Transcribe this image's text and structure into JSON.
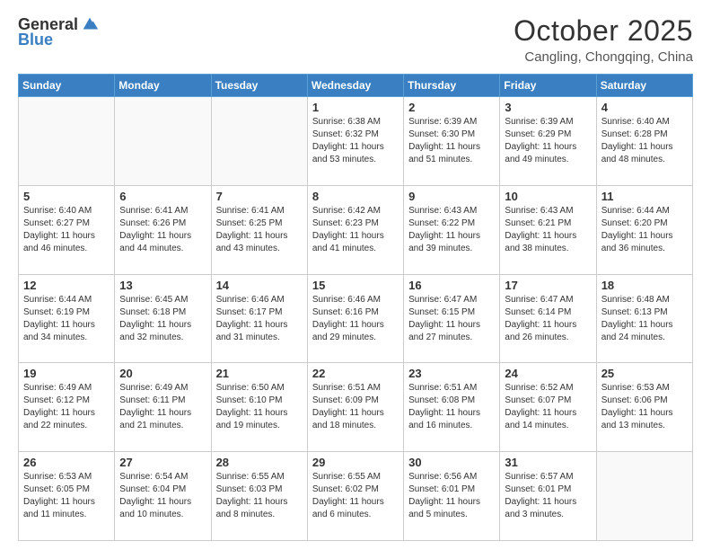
{
  "header": {
    "logo_general": "General",
    "logo_blue": "Blue",
    "month": "October 2025",
    "location": "Cangling, Chongqing, China"
  },
  "weekdays": [
    "Sunday",
    "Monday",
    "Tuesday",
    "Wednesday",
    "Thursday",
    "Friday",
    "Saturday"
  ],
  "weeks": [
    [
      {
        "day": "",
        "sunrise": "",
        "sunset": "",
        "daylight": ""
      },
      {
        "day": "",
        "sunrise": "",
        "sunset": "",
        "daylight": ""
      },
      {
        "day": "",
        "sunrise": "",
        "sunset": "",
        "daylight": ""
      },
      {
        "day": "1",
        "sunrise": "Sunrise: 6:38 AM",
        "sunset": "Sunset: 6:32 PM",
        "daylight": "Daylight: 11 hours and 53 minutes."
      },
      {
        "day": "2",
        "sunrise": "Sunrise: 6:39 AM",
        "sunset": "Sunset: 6:30 PM",
        "daylight": "Daylight: 11 hours and 51 minutes."
      },
      {
        "day": "3",
        "sunrise": "Sunrise: 6:39 AM",
        "sunset": "Sunset: 6:29 PM",
        "daylight": "Daylight: 11 hours and 49 minutes."
      },
      {
        "day": "4",
        "sunrise": "Sunrise: 6:40 AM",
        "sunset": "Sunset: 6:28 PM",
        "daylight": "Daylight: 11 hours and 48 minutes."
      }
    ],
    [
      {
        "day": "5",
        "sunrise": "Sunrise: 6:40 AM",
        "sunset": "Sunset: 6:27 PM",
        "daylight": "Daylight: 11 hours and 46 minutes."
      },
      {
        "day": "6",
        "sunrise": "Sunrise: 6:41 AM",
        "sunset": "Sunset: 6:26 PM",
        "daylight": "Daylight: 11 hours and 44 minutes."
      },
      {
        "day": "7",
        "sunrise": "Sunrise: 6:41 AM",
        "sunset": "Sunset: 6:25 PM",
        "daylight": "Daylight: 11 hours and 43 minutes."
      },
      {
        "day": "8",
        "sunrise": "Sunrise: 6:42 AM",
        "sunset": "Sunset: 6:23 PM",
        "daylight": "Daylight: 11 hours and 41 minutes."
      },
      {
        "day": "9",
        "sunrise": "Sunrise: 6:43 AM",
        "sunset": "Sunset: 6:22 PM",
        "daylight": "Daylight: 11 hours and 39 minutes."
      },
      {
        "day": "10",
        "sunrise": "Sunrise: 6:43 AM",
        "sunset": "Sunset: 6:21 PM",
        "daylight": "Daylight: 11 hours and 38 minutes."
      },
      {
        "day": "11",
        "sunrise": "Sunrise: 6:44 AM",
        "sunset": "Sunset: 6:20 PM",
        "daylight": "Daylight: 11 hours and 36 minutes."
      }
    ],
    [
      {
        "day": "12",
        "sunrise": "Sunrise: 6:44 AM",
        "sunset": "Sunset: 6:19 PM",
        "daylight": "Daylight: 11 hours and 34 minutes."
      },
      {
        "day": "13",
        "sunrise": "Sunrise: 6:45 AM",
        "sunset": "Sunset: 6:18 PM",
        "daylight": "Daylight: 11 hours and 32 minutes."
      },
      {
        "day": "14",
        "sunrise": "Sunrise: 6:46 AM",
        "sunset": "Sunset: 6:17 PM",
        "daylight": "Daylight: 11 hours and 31 minutes."
      },
      {
        "day": "15",
        "sunrise": "Sunrise: 6:46 AM",
        "sunset": "Sunset: 6:16 PM",
        "daylight": "Daylight: 11 hours and 29 minutes."
      },
      {
        "day": "16",
        "sunrise": "Sunrise: 6:47 AM",
        "sunset": "Sunset: 6:15 PM",
        "daylight": "Daylight: 11 hours and 27 minutes."
      },
      {
        "day": "17",
        "sunrise": "Sunrise: 6:47 AM",
        "sunset": "Sunset: 6:14 PM",
        "daylight": "Daylight: 11 hours and 26 minutes."
      },
      {
        "day": "18",
        "sunrise": "Sunrise: 6:48 AM",
        "sunset": "Sunset: 6:13 PM",
        "daylight": "Daylight: 11 hours and 24 minutes."
      }
    ],
    [
      {
        "day": "19",
        "sunrise": "Sunrise: 6:49 AM",
        "sunset": "Sunset: 6:12 PM",
        "daylight": "Daylight: 11 hours and 22 minutes."
      },
      {
        "day": "20",
        "sunrise": "Sunrise: 6:49 AM",
        "sunset": "Sunset: 6:11 PM",
        "daylight": "Daylight: 11 hours and 21 minutes."
      },
      {
        "day": "21",
        "sunrise": "Sunrise: 6:50 AM",
        "sunset": "Sunset: 6:10 PM",
        "daylight": "Daylight: 11 hours and 19 minutes."
      },
      {
        "day": "22",
        "sunrise": "Sunrise: 6:51 AM",
        "sunset": "Sunset: 6:09 PM",
        "daylight": "Daylight: 11 hours and 18 minutes."
      },
      {
        "day": "23",
        "sunrise": "Sunrise: 6:51 AM",
        "sunset": "Sunset: 6:08 PM",
        "daylight": "Daylight: 11 hours and 16 minutes."
      },
      {
        "day": "24",
        "sunrise": "Sunrise: 6:52 AM",
        "sunset": "Sunset: 6:07 PM",
        "daylight": "Daylight: 11 hours and 14 minutes."
      },
      {
        "day": "25",
        "sunrise": "Sunrise: 6:53 AM",
        "sunset": "Sunset: 6:06 PM",
        "daylight": "Daylight: 11 hours and 13 minutes."
      }
    ],
    [
      {
        "day": "26",
        "sunrise": "Sunrise: 6:53 AM",
        "sunset": "Sunset: 6:05 PM",
        "daylight": "Daylight: 11 hours and 11 minutes."
      },
      {
        "day": "27",
        "sunrise": "Sunrise: 6:54 AM",
        "sunset": "Sunset: 6:04 PM",
        "daylight": "Daylight: 11 hours and 10 minutes."
      },
      {
        "day": "28",
        "sunrise": "Sunrise: 6:55 AM",
        "sunset": "Sunset: 6:03 PM",
        "daylight": "Daylight: 11 hours and 8 minutes."
      },
      {
        "day": "29",
        "sunrise": "Sunrise: 6:55 AM",
        "sunset": "Sunset: 6:02 PM",
        "daylight": "Daylight: 11 hours and 6 minutes."
      },
      {
        "day": "30",
        "sunrise": "Sunrise: 6:56 AM",
        "sunset": "Sunset: 6:01 PM",
        "daylight": "Daylight: 11 hours and 5 minutes."
      },
      {
        "day": "31",
        "sunrise": "Sunrise: 6:57 AM",
        "sunset": "Sunset: 6:01 PM",
        "daylight": "Daylight: 11 hours and 3 minutes."
      },
      {
        "day": "",
        "sunrise": "",
        "sunset": "",
        "daylight": ""
      }
    ]
  ]
}
